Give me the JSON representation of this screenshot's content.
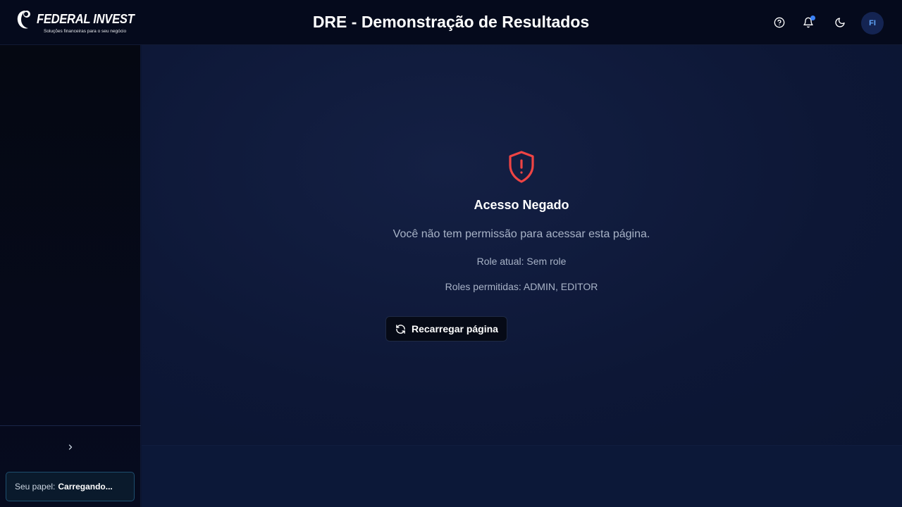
{
  "header": {
    "logo_name": "FEDERAL INVEST",
    "logo_tagline": "Soluções financeiras para o seu negócio",
    "title": "DRE - Demonstração de Resultados",
    "user_initials": "FI",
    "icons": [
      "help-icon",
      "bell-icon",
      "moon-icon"
    ],
    "notification_dot_color": "#3b82f6"
  },
  "sidebar": {
    "role_label": "Seu papel:",
    "role_value": "Carregando...",
    "collapse_icon": "chevron-right-icon"
  },
  "main": {
    "icon": "shield-alert-icon",
    "icon_color": "#ef4444",
    "title": "Acesso Negado",
    "message": "Você não tem permissão para acessar esta página.",
    "current_role": "Role atual: Sem role",
    "allowed_roles": "Roles permitidas: ADMIN, EDITOR",
    "reload_button": "Recarregar página"
  }
}
